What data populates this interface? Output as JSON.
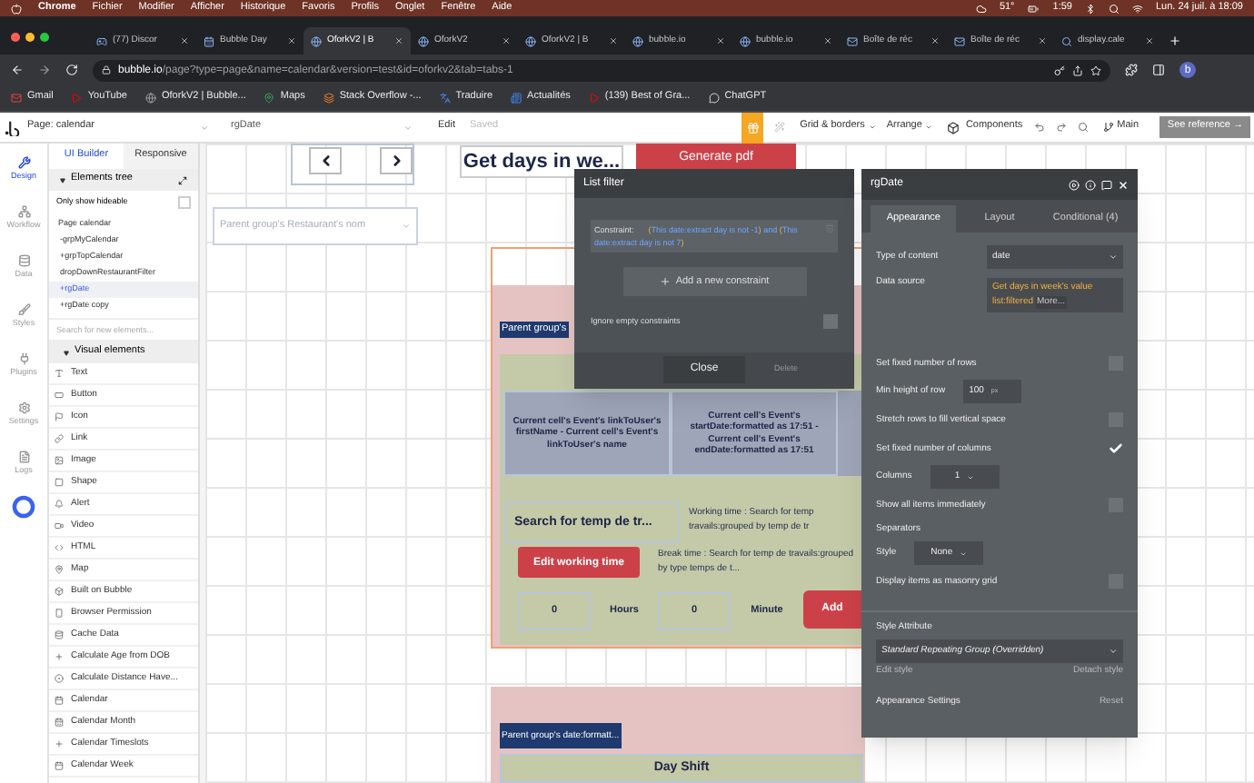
{
  "menubar": {
    "app": "Chrome",
    "menus": [
      "Fichier",
      "Modifier",
      "Afficher",
      "Historique",
      "Favoris",
      "Profils",
      "Onglet",
      "Fenêtre",
      "Aide"
    ],
    "temperature": "51°",
    "timer": "1:59",
    "clock": "Lun. 24 juil. à 18:09"
  },
  "browser_tabs": [
    {
      "title": "(77) Discor",
      "selected": false
    },
    {
      "title": "Bubble Day",
      "selected": false
    },
    {
      "title": "OforkV2 | B",
      "selected": true
    },
    {
      "title": "OforkV2",
      "selected": false
    },
    {
      "title": "OforkV2 | B",
      "selected": false
    },
    {
      "title": "bubble.io",
      "selected": false
    },
    {
      "title": "bubble.io",
      "selected": false
    },
    {
      "title": "Boîte de réc",
      "selected": false
    },
    {
      "title": "Boîte de réc",
      "selected": false
    },
    {
      "title": "display.cale",
      "selected": false
    }
  ],
  "address_bar": {
    "host": "bubble.io",
    "path": "/page?type=page&name=calendar&version=test&id=oforkv2&tab=tabs-1",
    "avatar": "b"
  },
  "bookmarks": [
    "Gmail",
    "YouTube",
    "OforkV2 | Bubble...",
    "Maps",
    "Stack Overflow -...",
    "Traduire",
    "Actualités",
    "(139) Best of Gra...",
    "ChatGPT"
  ],
  "editor_toolbar": {
    "page": "Page: calendar",
    "element": "rgDate",
    "edit": "Edit",
    "saved": "Saved",
    "grid": "Grid & borders",
    "arrange": "Arrange",
    "components": "Components",
    "branch": "Main",
    "reference": "See reference →"
  },
  "left_rail": [
    {
      "label": "Design",
      "selected": true
    },
    {
      "label": "Workflow",
      "selected": false
    },
    {
      "label": "Data",
      "selected": false
    },
    {
      "label": "Styles",
      "selected": false
    },
    {
      "label": "Plugins",
      "selected": false
    },
    {
      "label": "Settings",
      "selected": false
    },
    {
      "label": "Logs",
      "selected": false
    }
  ],
  "builder_tabs": [
    {
      "label": "UI Builder",
      "selected": true
    },
    {
      "label": "Responsive",
      "selected": false
    }
  ],
  "elements_tree": {
    "title": "Elements tree",
    "hideable": {
      "label": "Only show hideable",
      "checked": false
    },
    "items": [
      {
        "label": "Page calendar",
        "selected": false,
        "children": [
          {
            "label": "-grpMyCalendar",
            "selected": false
          },
          {
            "label": "+grpTopCalendar",
            "selected": false
          },
          {
            "label": "dropDownRestaurantFilter",
            "selected": false
          },
          {
            "label": "+rgDate",
            "selected": true
          },
          {
            "label": "+rgDate copy",
            "selected": false
          }
        ]
      }
    ]
  },
  "search": {
    "placeholder": "Search for new elements..."
  },
  "visual_elements": {
    "title": "Visual elements",
    "items": [
      "Text",
      "Button",
      "Icon",
      "Link",
      "Image",
      "Shape",
      "Alert",
      "Video",
      "HTML",
      "Map",
      "Built on Bubble",
      "Browser Permission",
      "Cache Data",
      "Calculate Age from DOB",
      "Calculate Distance Have...",
      "Calendar",
      "Calendar Month",
      "Calendar Timeslots",
      "Calendar Week"
    ]
  },
  "canvas": {
    "title": "Get days in we...",
    "pdf_button": "Generate pdf",
    "restaurant_dropdown": "Parent group's Restaurant's nom",
    "group_label": "Parent group's",
    "cells": [
      "Current cell's Event's linkToUser's firstName - Current cell's Event's linkToUser's name",
      "Current cell's Event's startDate:formatted as 17:51 - Current cell's Event's endDate:formatted as 17:51"
    ],
    "search_text": "Search for temp de tr...",
    "working_time": [
      "Working time : Search for temp",
      "travails:grouped by temp de tr"
    ],
    "edit_button": "Edit working time",
    "break_time": "Break time : Search for temp de travails:grouped by type temps de t...",
    "hours_value": "0",
    "hours_label": "Hours",
    "minutes_value": "0",
    "minutes_label": "Minute",
    "add_button": "Add",
    "second_group_label": "Parent group's date:formatt...",
    "day_shift": "Day Shift"
  },
  "list_filter": {
    "title": "List filter",
    "constraint_label": "Constraint:",
    "constraint_1": "(This date:extract day is not -1)",
    "joiner": "and",
    "constraint_2": "(This date:extract day is not 7)",
    "add": "Add a new constraint",
    "ignore": {
      "label": "Ignore empty constraints",
      "checked": false
    },
    "close": "Close",
    "delete": "Delete"
  },
  "property_panel": {
    "title": "rgDate",
    "tabs": [
      {
        "label": "Appearance",
        "selected": true
      },
      {
        "label": "Layout",
        "selected": false
      },
      {
        "label": "Conditional (4)",
        "selected": false
      }
    ],
    "rows": [
      {
        "kind": "dropdown",
        "label": "Type of content",
        "value": "date"
      },
      {
        "kind": "expression",
        "label": "Data source",
        "value": "Get days in week's value list:filtered",
        "link": "More..."
      },
      {
        "kind": "checkbox",
        "label": "Set fixed number of rows",
        "checked": false
      },
      {
        "kind": "unit",
        "label": "Min height of row",
        "value": "100",
        "unit": "px"
      },
      {
        "kind": "checkbox",
        "label": "Stretch rows to fill vertical space",
        "checked": false
      },
      {
        "kind": "checkbox",
        "label": "Set fixed number of columns",
        "checked": true
      },
      {
        "kind": "small_dropdown",
        "label": "Columns",
        "value": "1"
      },
      {
        "kind": "checkbox",
        "label": "Show all items immediately",
        "checked": false
      },
      {
        "kind": "heading",
        "label": "Separators"
      },
      {
        "kind": "small_dropdown",
        "label": "Style",
        "value": "None"
      },
      {
        "kind": "checkbox",
        "label": "Display items as masonry grid",
        "checked": false
      }
    ],
    "style_attribute": {
      "label": "Style Attribute",
      "value": "Standard Repeating Group (Overridden)",
      "edit": "Edit style",
      "detach": "Detach style"
    },
    "footer": {
      "label": "Appearance Settings",
      "action": "Reset"
    }
  }
}
